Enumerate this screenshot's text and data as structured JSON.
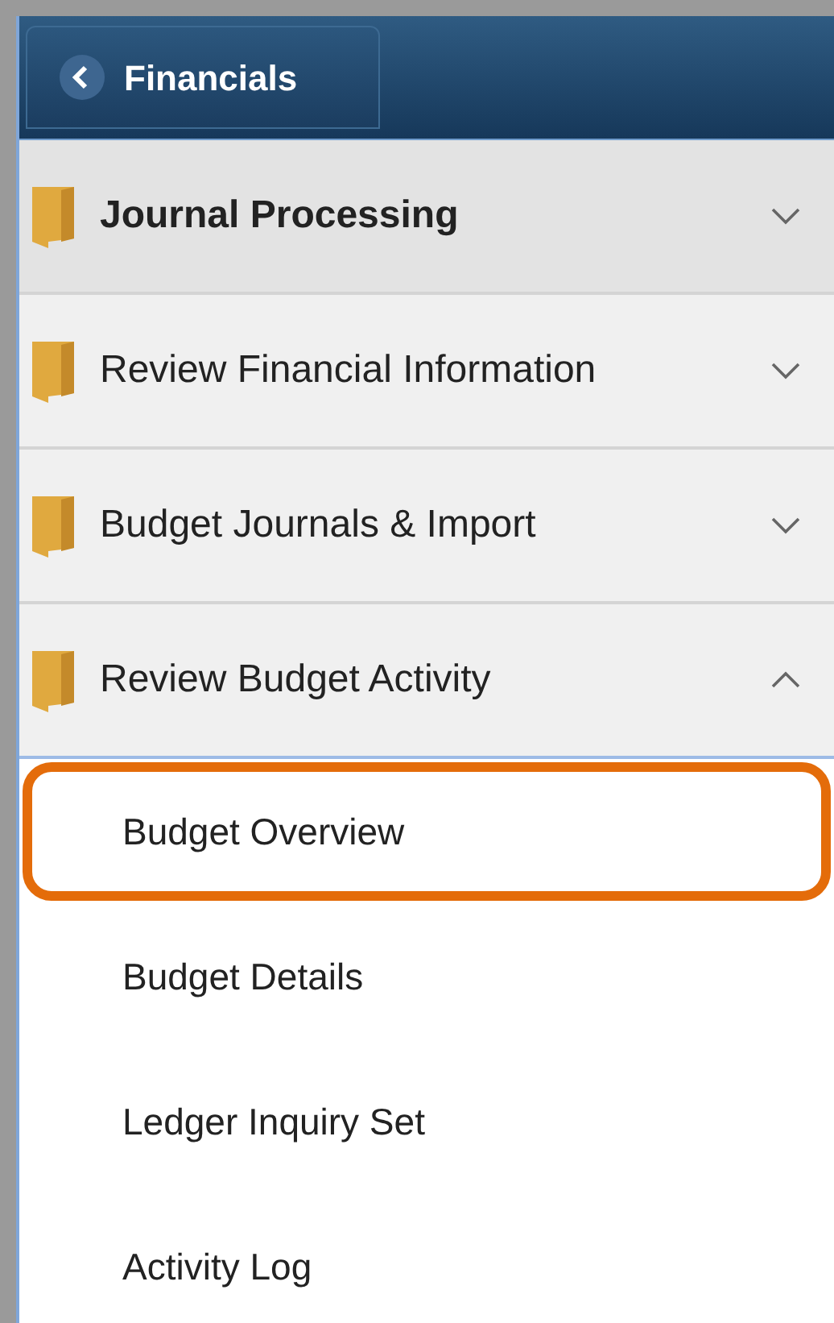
{
  "header": {
    "back_button": "Financials"
  },
  "folders": [
    {
      "label": "Journal Processing",
      "selected": true,
      "expanded": false
    },
    {
      "label": "Review Financial Information",
      "selected": false,
      "expanded": false
    },
    {
      "label": "Budget Journals & Import",
      "selected": false,
      "expanded": false
    },
    {
      "label": "Review Budget Activity",
      "selected": false,
      "expanded": true,
      "children": [
        {
          "label": "Budget Overview",
          "highlighted": true
        },
        {
          "label": "Budget Details",
          "highlighted": false
        },
        {
          "label": "Ledger Inquiry Set",
          "highlighted": false
        },
        {
          "label": "Activity Log",
          "highlighted": false
        }
      ]
    }
  ]
}
